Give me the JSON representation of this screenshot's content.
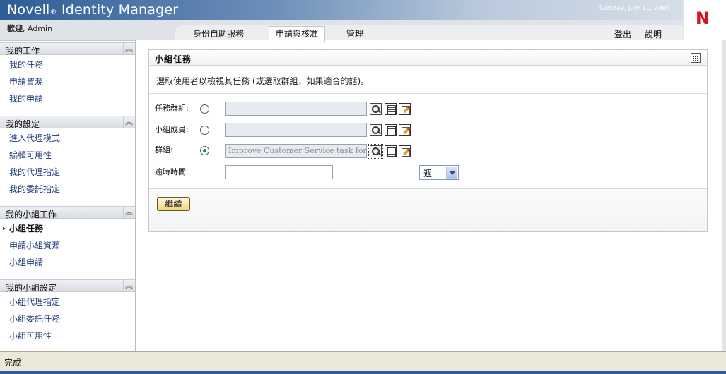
{
  "header": {
    "brand_name": "Novell",
    "brand_reg": "®",
    "brand_product": " Identity Manager",
    "date": "Tuesday, July 11, 2006",
    "logo_letter": "N",
    "welcome_bold": "歡迎",
    "welcome_user": ", Admin"
  },
  "tabs": [
    {
      "label": "身份自助服務",
      "active": false
    },
    {
      "label": "申請與核准",
      "active": true
    },
    {
      "label": "管理",
      "active": false
    }
  ],
  "top_links": {
    "logout": "登出",
    "help": "說明"
  },
  "sidebar": {
    "sections": [
      {
        "title": "我的工作",
        "collapse_icon": "double-chevron-up-icon",
        "items": [
          "我的任務",
          "申請資源",
          "我的申請"
        ]
      },
      {
        "title": "我的設定",
        "collapse_icon": "double-chevron-up-icon",
        "items": [
          "進入代理模式",
          "編輯可用性",
          "我的代理指定",
          "我的委託指定"
        ]
      },
      {
        "title": "我的小組工作",
        "collapse_icon": "double-chevron-up-icon",
        "items": [
          "小組任務",
          "申請小組資源",
          "小組申請"
        ],
        "current": "小組任務"
      },
      {
        "title": "我的小組設定",
        "collapse_icon": "double-chevron-up-icon",
        "items": [
          "小組代理指定",
          "小組委託任務",
          "小組可用性"
        ]
      }
    ]
  },
  "panel": {
    "title": "小組任務",
    "instructions": "選取使用者以檢視其任務 (或選取群組，如果適合的話)。",
    "fields": [
      {
        "label": "任務群組:",
        "value": "",
        "selected": false
      },
      {
        "label": "小組成員:",
        "value": "",
        "selected": false
      },
      {
        "label": "群組:",
        "value": "Improve Customer Service task force",
        "selected": true
      }
    ],
    "overdue_label": "逾時時間:",
    "overdue_value": "",
    "period_selected": "週",
    "continue_label": "繼續"
  },
  "status": {
    "text": "完成"
  },
  "colors": {
    "logo_red": "#d8121f",
    "link_blue": "#1e3a78",
    "button_gold": "#f2d37a",
    "banner_blue": "#2f5d96"
  }
}
